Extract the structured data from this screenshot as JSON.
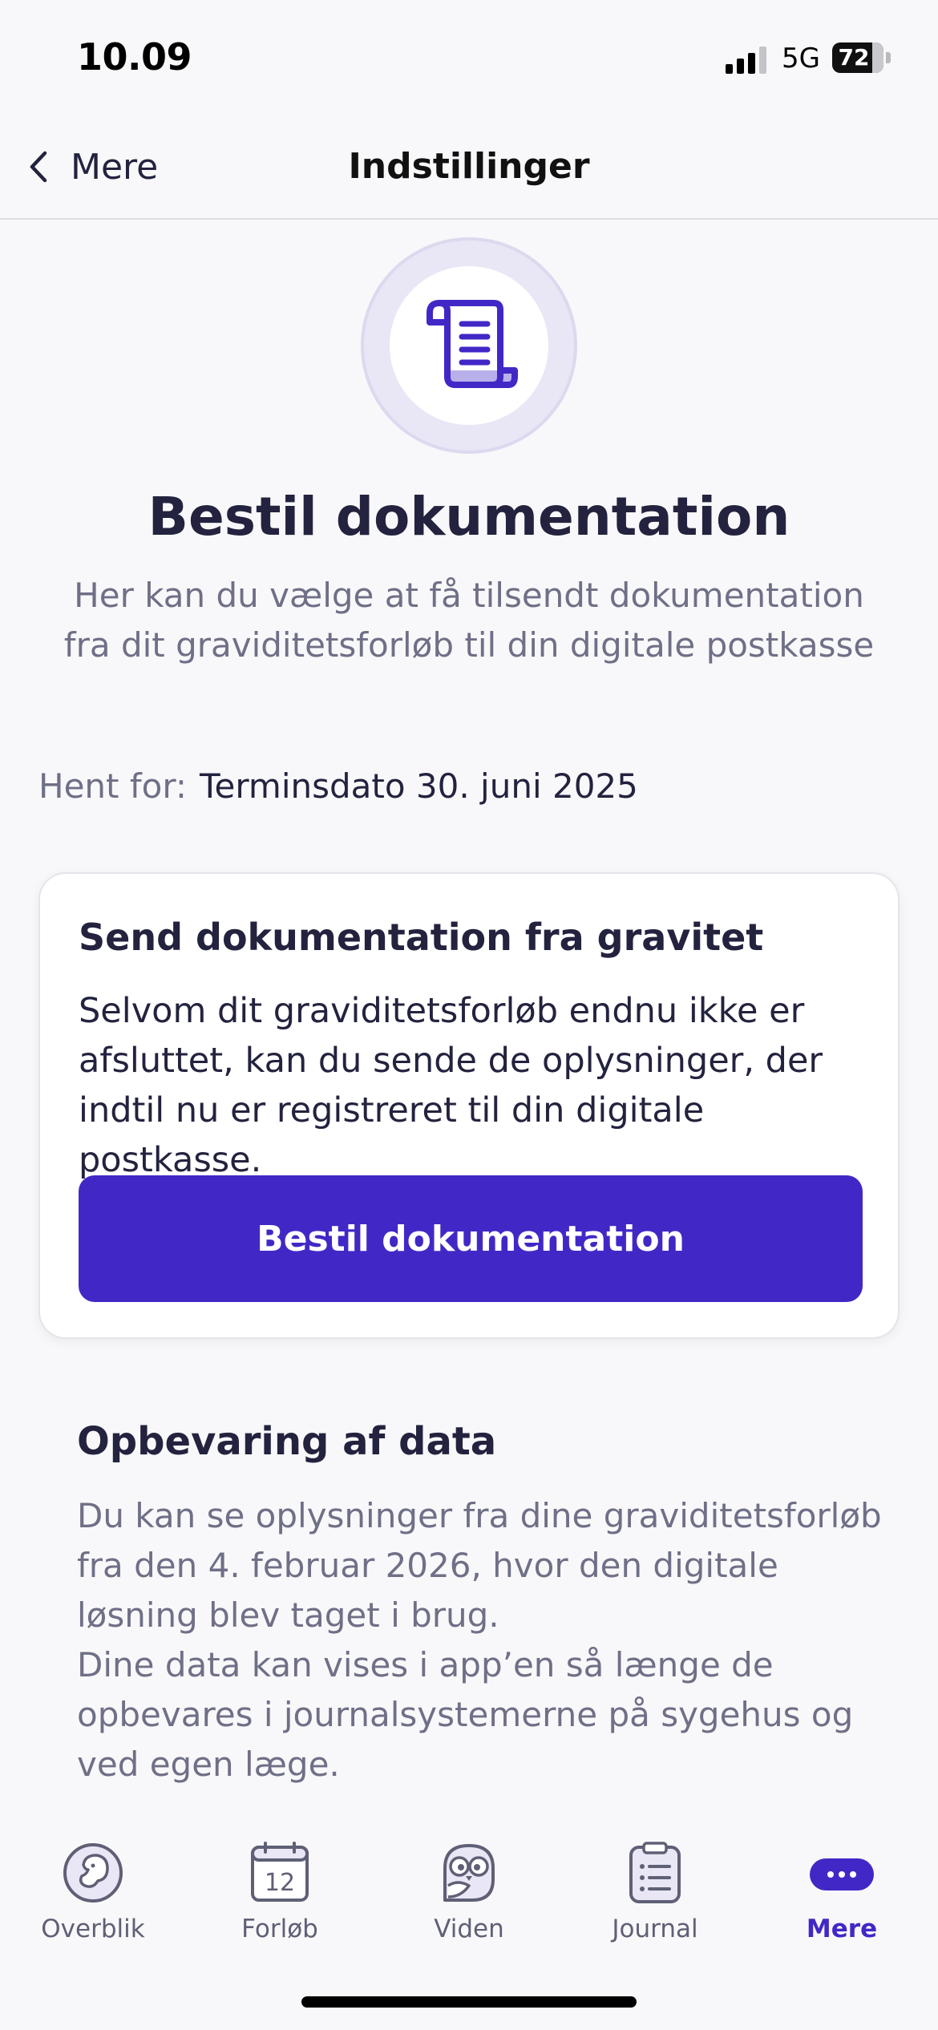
{
  "status_bar": {
    "time": "10.09",
    "network": "5G",
    "battery": "72"
  },
  "nav": {
    "back_label": "Mere",
    "title": "Indstillinger"
  },
  "hero": {
    "title": "Bestil dokumentation",
    "subtitle": "Her kan du vælge at få tilsendt dokumentation fra dit graviditetsforløb til din digitale postkasse"
  },
  "fetch": {
    "label": "Hent for:",
    "value": "Terminsdato 30. juni 2025"
  },
  "card": {
    "title": "Send dokumentation fra gravitet",
    "body": "Selvom dit graviditetsforløb endnu ikke er afsluttet, kan du sende de oplysninger, der indtil nu er registreret til din digitale postkasse.",
    "button_label": "Bestil dokumentation"
  },
  "data_section": {
    "title": "Opbevaring af data",
    "body": "Du kan se oplysninger fra dine graviditetsforløb fra den 4. februar 2026, hvor den digitale løsning blev taget i brug.\nDine data kan vises i app’en så længe de opbevares i  journalsystemerne på sygehus og ved egen læge."
  },
  "tabs": [
    {
      "label": "Overblik",
      "icon": "baby-icon",
      "active": false
    },
    {
      "label": "Forløb",
      "icon": "calendar-icon",
      "calendar_number": "12",
      "active": false
    },
    {
      "label": "Viden",
      "icon": "owl-icon",
      "active": false
    },
    {
      "label": "Journal",
      "icon": "clipboard-icon",
      "active": false
    },
    {
      "label": "Mere",
      "icon": "more-icon",
      "active": true
    }
  ],
  "colors": {
    "accent": "#4128c6",
    "text": "#23233f",
    "muted": "#6f6f87",
    "background": "#f8f8fa"
  }
}
